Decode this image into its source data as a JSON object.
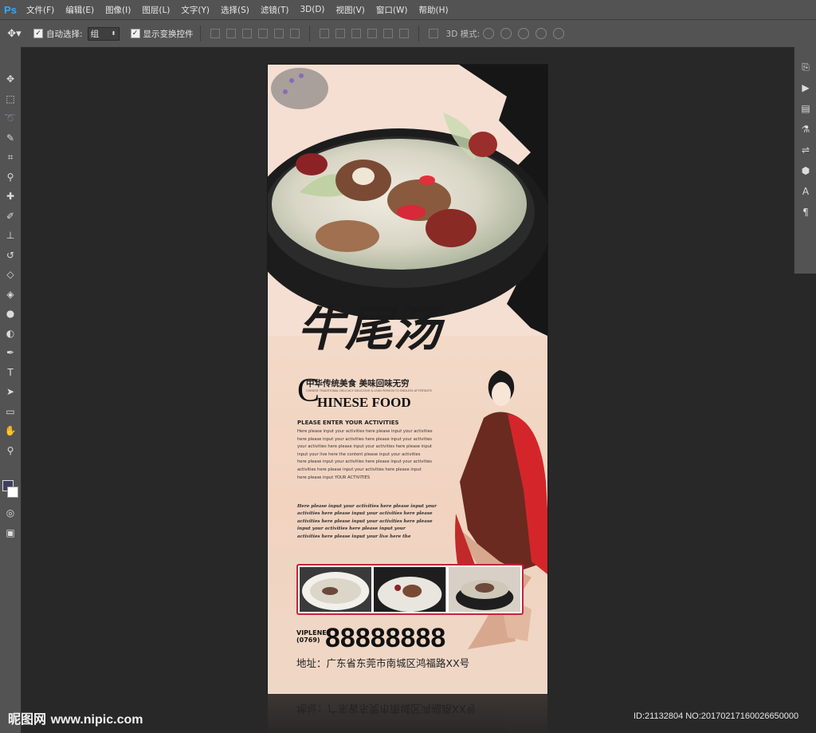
{
  "app": {
    "logo": "Ps"
  },
  "menu": [
    "文件(F)",
    "编辑(E)",
    "图像(I)",
    "图层(L)",
    "文字(Y)",
    "选择(S)",
    "滤镜(T)",
    "3D(D)",
    "视图(V)",
    "窗口(W)",
    "帮助(H)"
  ],
  "options": {
    "auto_select_label": "自动选择:",
    "auto_select_value": "组",
    "show_transform_label": "显示变换控件",
    "mode3d_label": "3D 模式:"
  },
  "tools": [
    "move-icon",
    "marquee-icon",
    "lasso-icon",
    "quick-select-icon",
    "crop-icon",
    "eyedropper-icon",
    "healing-icon",
    "brush-icon",
    "stamp-icon",
    "history-brush-icon",
    "eraser-icon",
    "paint-bucket-icon",
    "blur-icon",
    "dodge-icon",
    "pen-icon",
    "type-icon",
    "path-select-icon",
    "shape-icon",
    "hand-icon",
    "zoom-icon"
  ],
  "colors": {
    "foreground": "#3c4060",
    "background": "#ffffff",
    "accent_red": "#c0263a"
  },
  "poster": {
    "title": "牛尾汤",
    "slogan": "中华传统美食  美味回味无穷",
    "tiny_line": "CHINESE TRADITIONAL DELICACY DELICIOUS & LEAD PERSON TO ENDLESS AFTERTASTE",
    "cf_big": "C",
    "cf_rest": "HINESE FOOD",
    "enter_title": "PLEASE ENTER YOUR ACTIVITIES",
    "body_lines": [
      "Here please input your activities here please input your activities",
      "here please input your activities here please input your activities",
      "your activities here please input your activities here please input",
      "input your live here the content please input your activities",
      "here please input your activities here please input your activities",
      "  activities here please input your activities here please input",
      "here please input YOUR ACTIVITIES"
    ],
    "italic_lines": [
      "Here please input your activities here please input your",
      "activities here please input your activities here please",
      "activities here please input your activities here please",
      "input your activities here please input your",
      "activities here please input your live here the"
    ],
    "phone_label_1": "VIPLENE",
    "phone_label_2": "(0769)",
    "phone_number": "88888888",
    "address": "地址：广东省东莞市南城区鸿福路XX号"
  },
  "watermark": {
    "left_brand": "昵图网",
    "left_url": "www.nipic.com",
    "right_id": "ID:21132804 NO:20170217160026650000"
  }
}
